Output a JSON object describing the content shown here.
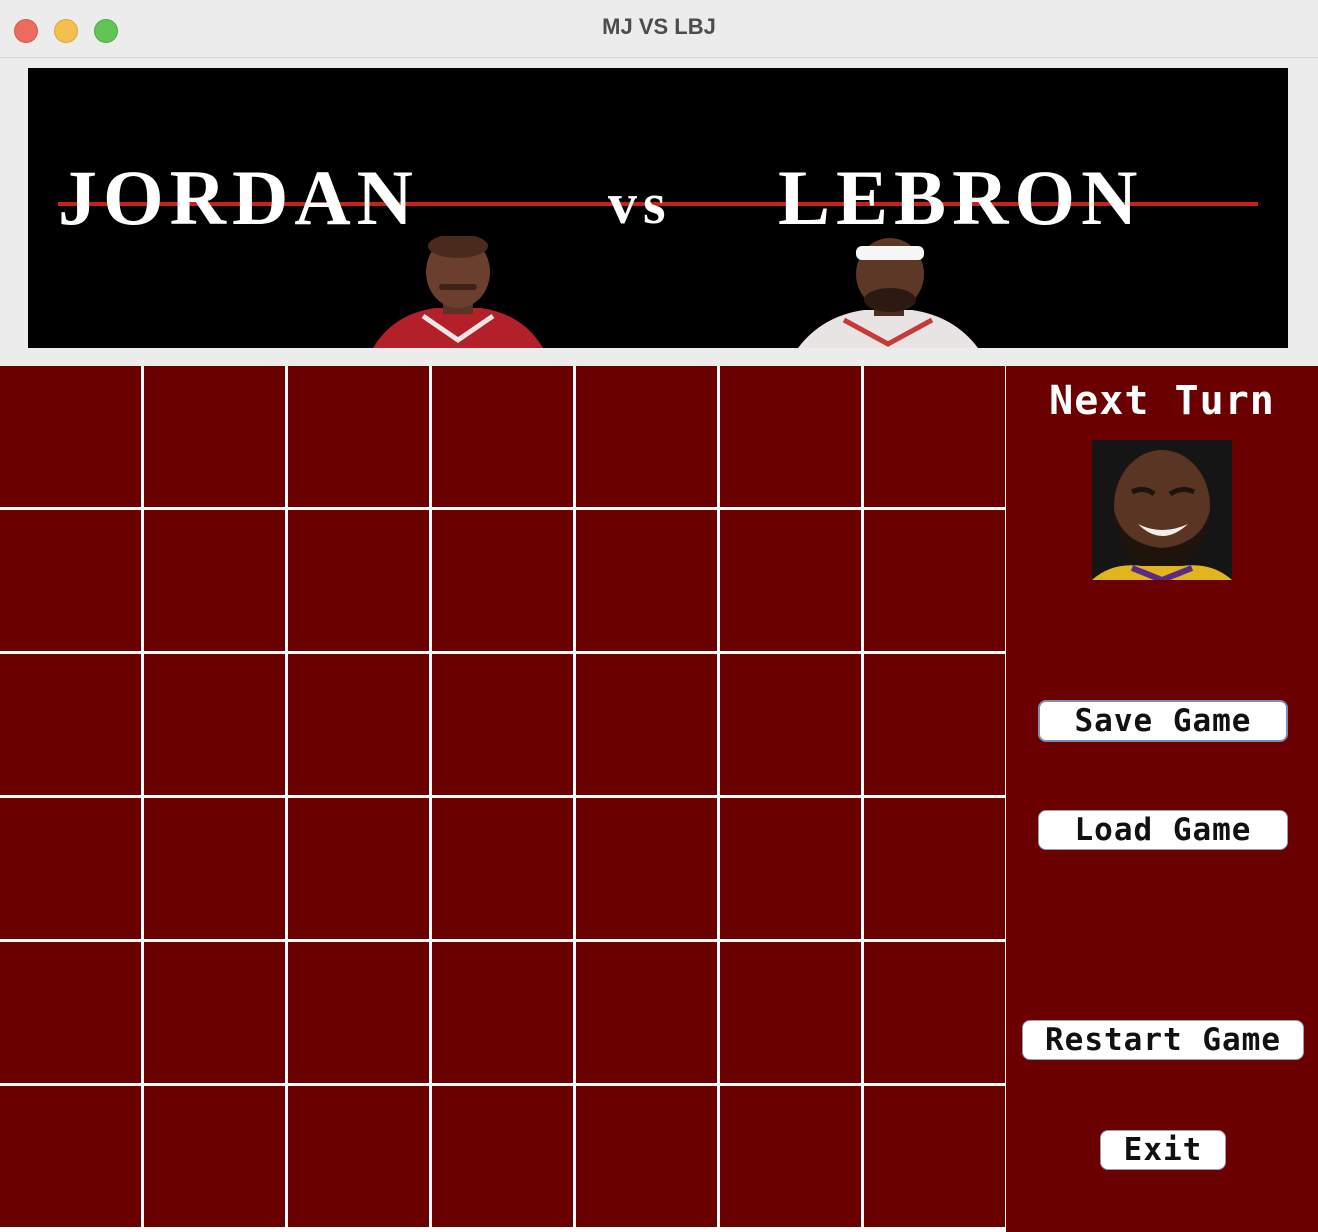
{
  "window": {
    "title": "MJ VS LBJ"
  },
  "banner": {
    "left_name": "JORDAN",
    "vs": "vs",
    "right_name": "LEBRON"
  },
  "board": {
    "rows": 6,
    "columns": 7,
    "cell_color": "#6a0000",
    "grid_color": "#ffffff"
  },
  "side_panel": {
    "next_turn_label": "Next Turn",
    "current_player_avatar": "lebron-face-avatar"
  },
  "buttons": {
    "save": "Save Game",
    "load": "Load Game",
    "restart": "Restart Game",
    "exit": "Exit"
  },
  "colors": {
    "background": "#6a0000",
    "accent_rule": "#c8201c",
    "button_bg": "#ffffff"
  }
}
